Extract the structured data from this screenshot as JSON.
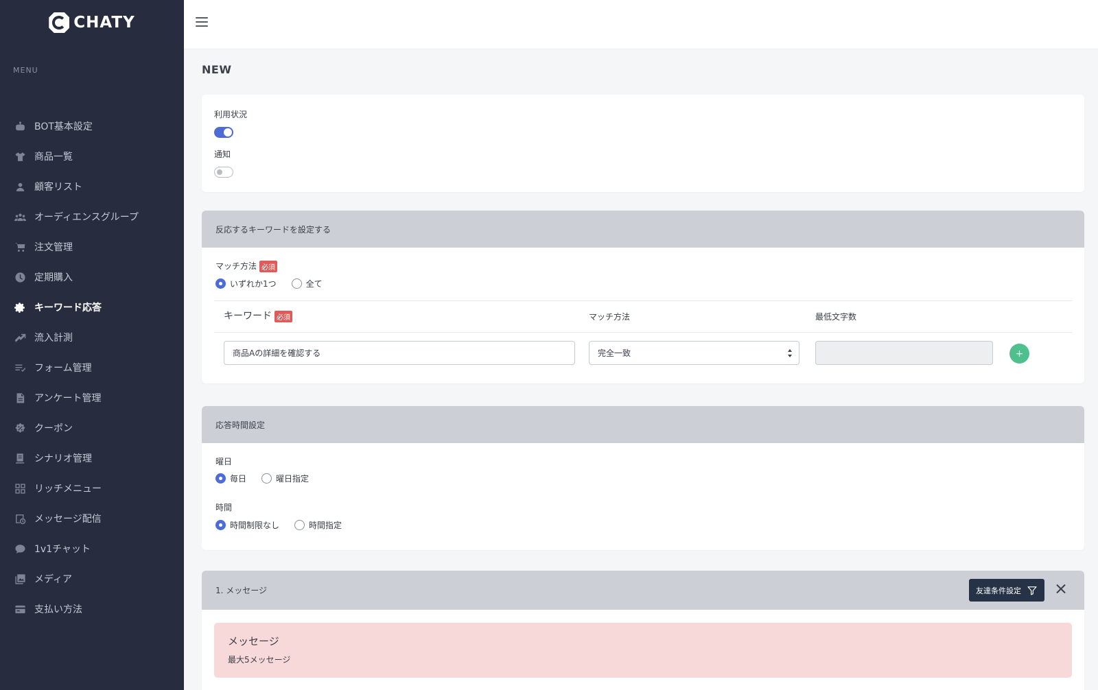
{
  "brand": {
    "name": "CHATY"
  },
  "sidebar": {
    "menu_label": "MENU",
    "items": [
      {
        "label": "BOT基本設定",
        "icon": "robot-icon"
      },
      {
        "label": "商品一覧",
        "icon": "shirt-icon"
      },
      {
        "label": "顧客リスト",
        "icon": "person-icon"
      },
      {
        "label": "オーディエンスグループ",
        "icon": "group-icon"
      },
      {
        "label": "注文管理",
        "icon": "cart-icon"
      },
      {
        "label": "定期購入",
        "icon": "clock-icon"
      },
      {
        "label": "キーワード応答",
        "icon": "gear-icon",
        "active": true
      },
      {
        "label": "流入計測",
        "icon": "tracking-icon"
      },
      {
        "label": "フォーム管理",
        "icon": "form-list-icon"
      },
      {
        "label": "アンケート管理",
        "icon": "survey-icon"
      },
      {
        "label": "クーポン",
        "icon": "coupon-icon"
      },
      {
        "label": "シナリオ管理",
        "icon": "scenario-icon"
      },
      {
        "label": "リッチメニュー",
        "icon": "grid-icon"
      },
      {
        "label": "メッセージ配信",
        "icon": "message-send-icon"
      },
      {
        "label": "1v1チャット",
        "icon": "chat-icon"
      },
      {
        "label": "メディア",
        "icon": "media-icon"
      },
      {
        "label": "支払い方法",
        "icon": "credit-card-icon"
      }
    ]
  },
  "page": {
    "title": "NEW"
  },
  "status_card": {
    "usage_label": "利用状況",
    "usage_on": true,
    "notify_label": "通知",
    "notify_on": false
  },
  "keyword_card": {
    "header": "反応するキーワードを設定する",
    "match_label": "マッチ方法",
    "required": "必須",
    "match_options": [
      "いずれか1つ",
      "全て"
    ],
    "match_selected": 0,
    "columns": {
      "keyword": "キーワード",
      "match": "マッチ方法",
      "min_chars": "最低文字数"
    },
    "row": {
      "keyword_value": "商品Aの詳細を確認する",
      "match_value": "完全一致",
      "min_chars_value": ""
    },
    "add_label": "+"
  },
  "time_card": {
    "header": "応答時間設定",
    "weekday_label": "曜日",
    "weekday_options": [
      "毎日",
      "曜日指定"
    ],
    "weekday_selected": 0,
    "time_label": "時間",
    "time_options": [
      "時間制限なし",
      "時間指定"
    ],
    "time_selected": 0
  },
  "message_card": {
    "header": "1. メッセージ",
    "filter_button": "友達条件設定",
    "box_title": "メッセージ",
    "box_sub": "最大5メッセージ"
  },
  "colors": {
    "sidebar_bg": "#272d3e",
    "accent": "#4e6bd6",
    "add_green": "#4fc08d",
    "required_red": "#e05a5a",
    "card_header": "#ccd0d6",
    "message_pink": "#f8d9d9"
  }
}
